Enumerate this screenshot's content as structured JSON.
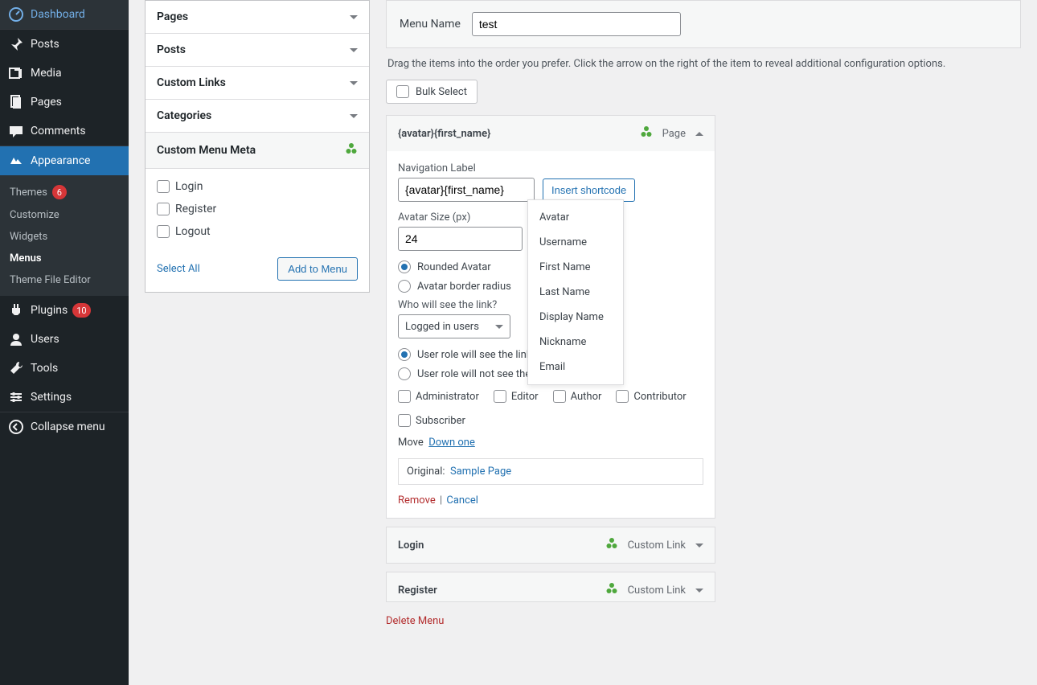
{
  "sidebar": {
    "dashboard": "Dashboard",
    "posts": "Posts",
    "media": "Media",
    "pages": "Pages",
    "comments": "Comments",
    "appearance": "Appearance",
    "sub_themes": "Themes",
    "themes_badge": "6",
    "sub_customize": "Customize",
    "sub_widgets": "Widgets",
    "sub_menus": "Menus",
    "sub_tfe": "Theme File Editor",
    "plugins": "Plugins",
    "plugins_badge": "10",
    "users": "Users",
    "tools": "Tools",
    "settings": "Settings",
    "collapse": "Collapse menu"
  },
  "accordion": {
    "pages": "Pages",
    "posts": "Posts",
    "custom_links": "Custom Links",
    "categories": "Categories",
    "custom_menu_meta": "Custom Menu Meta",
    "login": "Login",
    "register": "Register",
    "logout": "Logout",
    "select_all": "Select All",
    "add_to_menu": "Add to Menu"
  },
  "content": {
    "menu_name_label": "Menu Name",
    "menu_name_value": "test",
    "help_text": "Drag the items into the order you prefer. Click the arrow on the right of the item to reveal additional configuration options.",
    "bulk_select": "Bulk Select",
    "delete_menu": "Delete Menu"
  },
  "item": {
    "title": "{avatar}{first_name}",
    "type": "Page",
    "nav_label_label": "Navigation Label",
    "nav_label_value": "{avatar}{first_name}",
    "insert_shortcode": "Insert shortcode",
    "avatar_size_label": "Avatar Size (px)",
    "avatar_size_value": "24",
    "rounded_avatar": "Rounded Avatar",
    "avatar_border_radius": "Avatar border radius",
    "who_label": "Who will see the link?",
    "who_value": "Logged in users",
    "role_will_see": "User role will see the link",
    "role_will_not_see": "User role will not see the link",
    "role_admin": "Administrator",
    "role_editor": "Editor",
    "role_author": "Author",
    "role_contributor": "Contributor",
    "role_subscriber": "Subscriber",
    "move_label": "Move",
    "move_down_one": "Down one",
    "original_label": "Original:",
    "original_value": "Sample Page",
    "remove": "Remove",
    "cancel": "Cancel"
  },
  "dropdown": {
    "avatar": "Avatar",
    "username": "Username",
    "first_name": "First Name",
    "last_name": "Last Name",
    "display_name": "Display Name",
    "nickname": "Nickname",
    "email": "Email"
  },
  "items2": {
    "login_title": "Login",
    "login_type": "Custom Link",
    "register_title": "Register",
    "register_type": "Custom Link"
  }
}
